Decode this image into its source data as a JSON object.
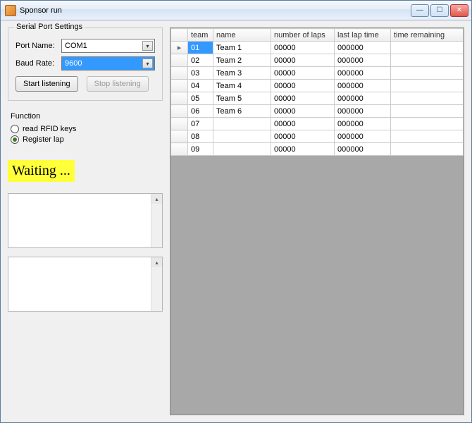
{
  "window": {
    "title": "Sponsor run"
  },
  "serial": {
    "legend": "Serial Port Settings",
    "port_label": "Port Name:",
    "port_value": "COM1",
    "baud_label": "Baud Rate:",
    "baud_value": "9600",
    "start_label": "Start listening",
    "stop_label": "Stop listening"
  },
  "function": {
    "title": "Function",
    "opt_read": "read RFID keys",
    "opt_register": "Register lap",
    "selected": "register"
  },
  "status": {
    "text": "Waiting ..."
  },
  "grid": {
    "headers": {
      "team": "team",
      "name": "name",
      "laps": "number of laps",
      "last": "last lap time",
      "rem": "time remaining"
    },
    "rows": [
      {
        "team": "01",
        "name": "Team 1",
        "laps": "00000",
        "last": "000000",
        "rem": ""
      },
      {
        "team": "02",
        "name": "Team 2",
        "laps": "00000",
        "last": "000000",
        "rem": ""
      },
      {
        "team": "03",
        "name": "Team 3",
        "laps": "00000",
        "last": "000000",
        "rem": ""
      },
      {
        "team": "04",
        "name": "Team 4",
        "laps": "00000",
        "last": "000000",
        "rem": ""
      },
      {
        "team": "05",
        "name": "Team 5",
        "laps": "00000",
        "last": "000000",
        "rem": ""
      },
      {
        "team": "06",
        "name": "Team 6",
        "laps": "00000",
        "last": "000000",
        "rem": ""
      },
      {
        "team": "07",
        "name": "",
        "laps": "00000",
        "last": "000000",
        "rem": ""
      },
      {
        "team": "08",
        "name": "",
        "laps": "00000",
        "last": "000000",
        "rem": ""
      },
      {
        "team": "09",
        "name": "",
        "laps": "00000",
        "last": "000000",
        "rem": ""
      }
    ]
  }
}
